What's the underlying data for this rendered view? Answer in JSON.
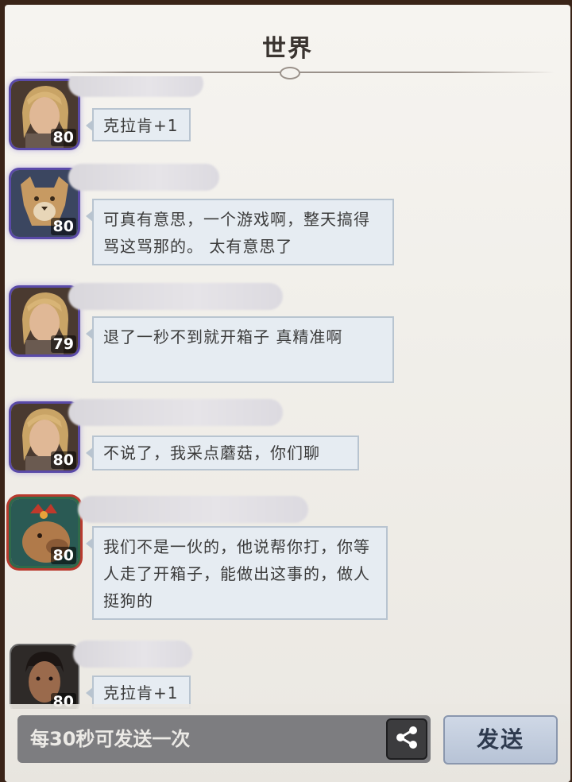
{
  "header": {
    "title": "世界"
  },
  "messages": [
    {
      "level": "80",
      "text": "克拉肯+1",
      "avatar_icon": "blonde-man-avatar"
    },
    {
      "level": "80",
      "text": "可真有意思，一个游戏啊，整天搞得骂这骂那的。 太有意思了",
      "avatar_icon": "puma-avatar"
    },
    {
      "level": "79",
      "text": "退了一秒不到就开箱子 真精准啊",
      "avatar_icon": "blonde-man-avatar"
    },
    {
      "level": "80",
      "text": "不说了，我采点蘑菇，你们聊",
      "avatar_icon": "blonde-man-avatar"
    },
    {
      "level": "80",
      "text": "我们不是一伙的，他说帮你打，你等人走了开箱子，能做出这事的，做人挺狗的",
      "avatar_icon": "capybara-avatar"
    },
    {
      "level": "80",
      "text": "克拉肯+1",
      "avatar_icon": "dark-hair-man-avatar"
    }
  ],
  "footer": {
    "input_placeholder": "每30秒可发送一次",
    "share_icon": "share-icon",
    "send_label": "发送"
  },
  "colors": {
    "bubble_bg": "#e6ecf2",
    "bubble_border": "#b8c4d0",
    "avatar_glow": "#5a4aa8",
    "send_bg": "#c3cddd"
  }
}
